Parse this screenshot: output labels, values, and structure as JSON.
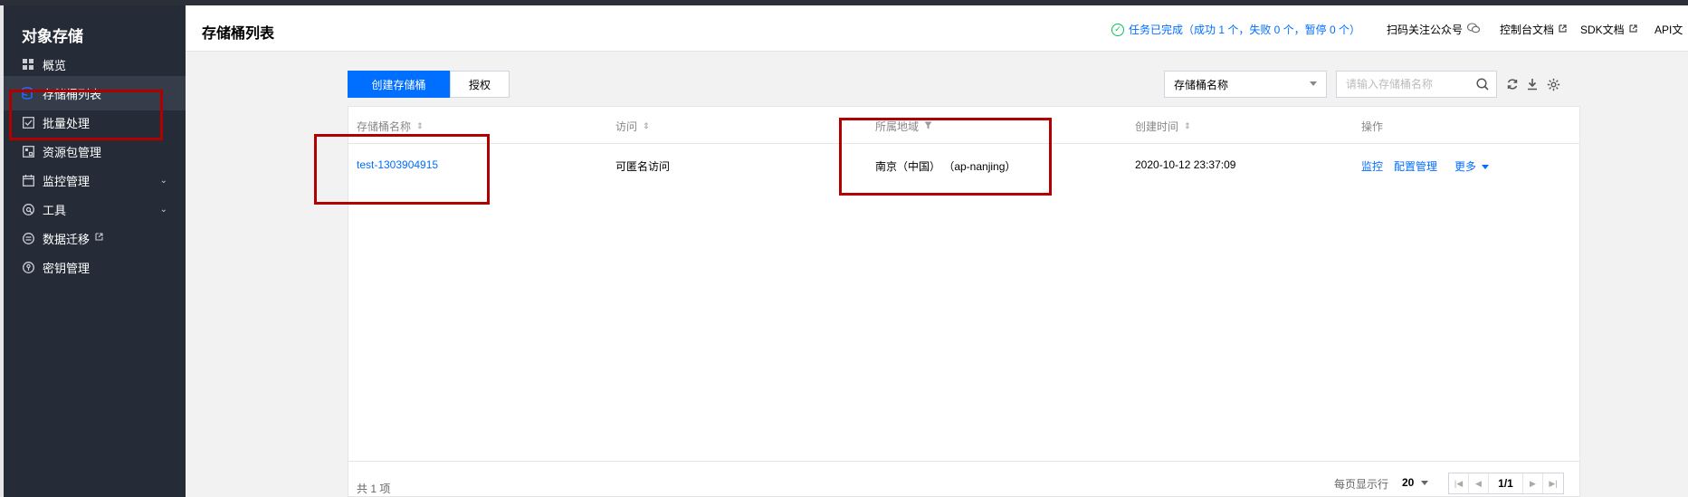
{
  "app": {
    "title": "对象存储"
  },
  "sidebar": {
    "items": [
      {
        "label": "概览",
        "icon": "dashboard-icon"
      },
      {
        "label": "存储桶列表",
        "icon": "bucket-icon",
        "active": true
      },
      {
        "label": "批量处理",
        "icon": "batch-icon"
      },
      {
        "label": "资源包管理",
        "icon": "package-icon"
      },
      {
        "label": "监控管理",
        "icon": "calendar-icon",
        "expandable": true
      },
      {
        "label": "工具",
        "icon": "tool-icon",
        "expandable": true
      },
      {
        "label": "数据迁移",
        "icon": "migration-icon",
        "external": true
      },
      {
        "label": "密钥管理",
        "icon": "key-icon"
      }
    ]
  },
  "header": {
    "title": "存储桶列表",
    "task_status": "任务已完成（成功 1 个，失败 0 个，暂停 0 个）",
    "links": {
      "wechat": "扫码关注公众号",
      "console_docs": "控制台文档",
      "sdk_docs": "SDK文档",
      "api_docs": "API文"
    }
  },
  "toolbar": {
    "create_label": "创建存储桶",
    "auth_label": "授权",
    "filter_select": "存储桶名称",
    "search_placeholder": "请输入存储桶名称"
  },
  "table": {
    "columns": [
      "存储桶名称",
      "访问",
      "所属地域",
      "创建时间",
      "操作"
    ],
    "rows": [
      {
        "name": "test-1303904915",
        "access": "可匿名访问",
        "region": "南京（中国） （ap-nanjing）",
        "created": "2020-10-12 23:37:09",
        "actions": [
          "监控",
          "配置管理",
          "更多"
        ]
      }
    ]
  },
  "footer": {
    "total": "共 1 项",
    "page_size_label": "每页显示行",
    "page_size": "20",
    "page": "1/1"
  },
  "colors": {
    "sidebar_bg": "#262c37",
    "accent": "#006eff",
    "success": "#0abf5b",
    "annotation_red": "#b00000"
  }
}
